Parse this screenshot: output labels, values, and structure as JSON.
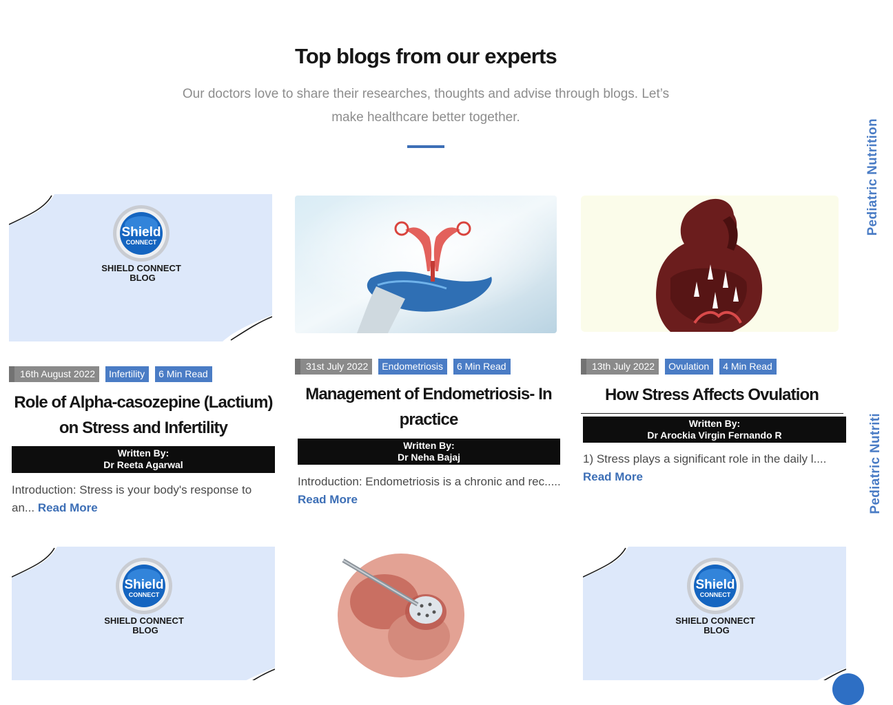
{
  "section": {
    "title": "Top blogs from our experts",
    "subtitle": "Our doctors love to share their researches, thoughts and advise through blogs. Let’s make healthcare better together."
  },
  "side_tabs": [
    "Pediatric Nutrition",
    "Pediatric Nutriti"
  ],
  "placeholder": {
    "logo_line1": "Shield",
    "logo_line2": "CONNECT",
    "caption_line1": "SHIELD CONNECT",
    "caption_line2": "BLOG"
  },
  "posts": [
    {
      "date": "16th August 2022",
      "category": "Infertility",
      "read_time": "6 Min Read",
      "title": "Role of Alpha-casozepine (Lactium) on Stress and Infertility",
      "written_by_label": "Written By:",
      "author": "Dr Reeta Agarwal",
      "excerpt": "Introduction: Stress is your body's response to an...",
      "read_more": "Read More",
      "thumb": "shield-connect-placeholder"
    },
    {
      "date": "31st July 2022",
      "category": "Endometriosis",
      "read_time": "6 Min Read",
      "title": "Management of Endometriosis- In practice",
      "written_by_label": "Written By:",
      "author": "Dr Neha Bajaj",
      "excerpt": "Introduction: Endometriosis is a chronic and rec.....",
      "read_more": "Read More",
      "thumb": "uterus-hologram-hand"
    },
    {
      "date": "13th July 2022",
      "category": "Ovulation",
      "read_time": "4 Min Read",
      "title": "How Stress Affects Ovulation",
      "written_by_label": "Written By:",
      "author": "Dr Arockia Virgin Fernando R",
      "excerpt": "1) Stress plays a significant role in the daily l....",
      "read_more": "Read More",
      "thumb": "stressed-woman-silhouette"
    }
  ],
  "second_row_thumbs": [
    "shield-connect-placeholder",
    "ovary-surgery-illustration",
    "shield-connect-placeholder"
  ]
}
